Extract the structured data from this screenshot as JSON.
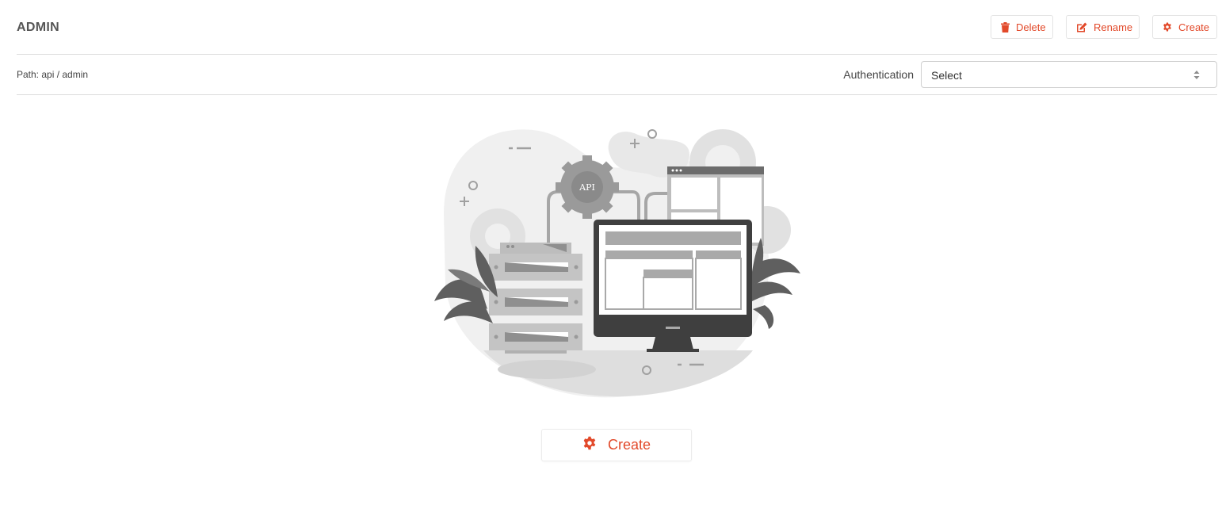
{
  "header": {
    "title": "ADMIN",
    "actions": {
      "delete_label": "Delete",
      "rename_label": "Rename",
      "create_label": "Create"
    }
  },
  "pathbar": {
    "path": "Path: api / admin",
    "auth_label": "Authentication",
    "auth_select_value": "Select"
  },
  "illustration": {
    "gear_label": "API"
  },
  "empty_state": {
    "create_label": "Create"
  },
  "colors": {
    "accent": "#e2492a",
    "border": "#dcdcdc",
    "illustration_gray": "#9a9a9a"
  },
  "icons": {
    "delete": "trash-icon",
    "rename": "edit-icon",
    "create": "gear-icon",
    "select": "sort-arrows-icon"
  }
}
